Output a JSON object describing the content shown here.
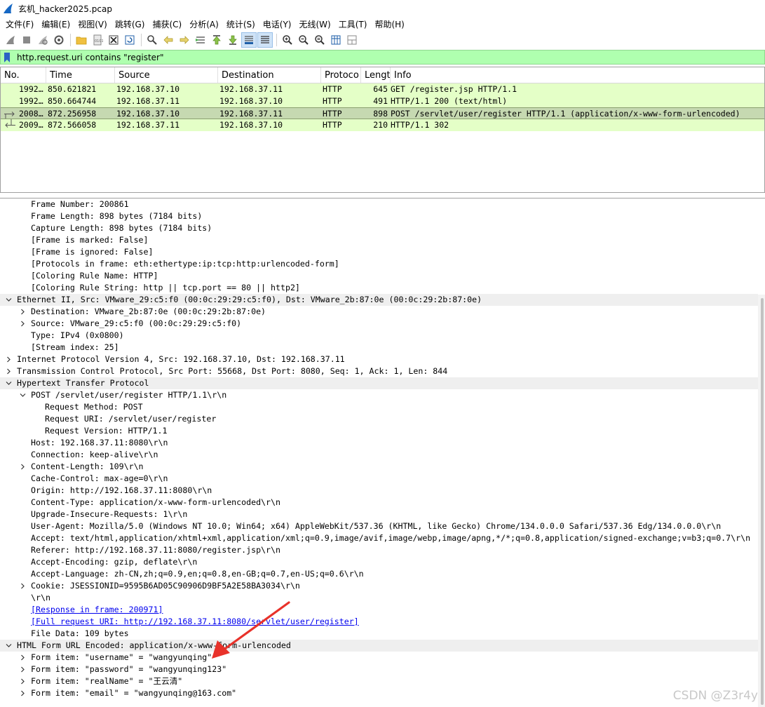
{
  "window": {
    "title": "玄机_hacker2025.pcap"
  },
  "menu": [
    "文件(F)",
    "编辑(E)",
    "视图(V)",
    "跳转(G)",
    "捕获(C)",
    "分析(A)",
    "统计(S)",
    "电话(Y)",
    "无线(W)",
    "工具(T)",
    "帮助(H)"
  ],
  "toolbar_icons": [
    "shark-start-icon",
    "stop-icon",
    "restart-icon",
    "options-icon",
    "open-folder-icon",
    "save-icon",
    "close-file-icon",
    "reload-icon",
    "find-icon",
    "go-back-icon",
    "go-forward-icon",
    "go-to-packet-icon",
    "first-packet-icon",
    "last-packet-icon",
    "autoscroll-icon",
    "colorize-icon",
    "zoom-in-icon",
    "zoom-out-icon",
    "zoom-normal-icon",
    "resize-columns-icon",
    "layout-icon"
  ],
  "filter": {
    "value": "http.request.uri contains \"register\""
  },
  "packet_list": {
    "columns": [
      "No.",
      "Time",
      "Source",
      "Destination",
      "Protoco",
      "Lengt",
      "Info"
    ],
    "rows": [
      {
        "no": "1992…",
        "time": "850.621821",
        "src": "192.168.37.10",
        "dst": "192.168.37.11",
        "proto": "HTTP",
        "len": "645",
        "info": "GET /register.jsp HTTP/1.1",
        "rel": "none"
      },
      {
        "no": "1992…",
        "time": "850.664744",
        "src": "192.168.37.11",
        "dst": "192.168.37.10",
        "proto": "HTTP",
        "len": "491",
        "info": "HTTP/1.1 200   (text/html)",
        "rel": "none"
      },
      {
        "no": "2008…",
        "time": "872.256958",
        "src": "192.168.37.10",
        "dst": "192.168.37.11",
        "proto": "HTTP",
        "len": "898",
        "info": "POST /servlet/user/register HTTP/1.1  (application/x-www-form-urlencoded)",
        "rel": "request"
      },
      {
        "no": "2009…",
        "time": "872.566058",
        "src": "192.168.37.11",
        "dst": "192.168.37.10",
        "proto": "HTTP",
        "len": "210",
        "info": "HTTP/1.1 302",
        "rel": "response"
      }
    ]
  },
  "details": [
    {
      "indent": 2,
      "arrow": "",
      "text": "Frame Number: 200861"
    },
    {
      "indent": 2,
      "arrow": "",
      "text": "Frame Length: 898 bytes (7184 bits)"
    },
    {
      "indent": 2,
      "arrow": "",
      "text": "Capture Length: 898 bytes (7184 bits)"
    },
    {
      "indent": 2,
      "arrow": "",
      "text": "[Frame is marked: False]"
    },
    {
      "indent": 2,
      "arrow": "",
      "text": "[Frame is ignored: False]"
    },
    {
      "indent": 2,
      "arrow": "",
      "text": "[Protocols in frame: eth:ethertype:ip:tcp:http:urlencoded-form]"
    },
    {
      "indent": 2,
      "arrow": "",
      "text": "[Coloring Rule Name: HTTP]"
    },
    {
      "indent": 2,
      "arrow": "",
      "text": "[Coloring Rule String: http || tcp.port == 80 || http2]"
    },
    {
      "indent": 1,
      "arrow": "open",
      "text": "Ethernet II, Src: VMware_29:c5:f0 (00:0c:29:29:c5:f0), Dst: VMware_2b:87:0e (00:0c:29:2b:87:0e)",
      "hl": true
    },
    {
      "indent": 2,
      "arrow": "closed",
      "text": "Destination: VMware_2b:87:0e (00:0c:29:2b:87:0e)"
    },
    {
      "indent": 2,
      "arrow": "closed",
      "text": "Source: VMware_29:c5:f0 (00:0c:29:29:c5:f0)"
    },
    {
      "indent": 2,
      "arrow": "",
      "text": "Type: IPv4 (0x0800)"
    },
    {
      "indent": 2,
      "arrow": "",
      "text": "[Stream index: 25]"
    },
    {
      "indent": 1,
      "arrow": "closed",
      "text": "Internet Protocol Version 4, Src: 192.168.37.10, Dst: 192.168.37.11"
    },
    {
      "indent": 1,
      "arrow": "closed",
      "text": "Transmission Control Protocol, Src Port: 55668, Dst Port: 8080, Seq: 1, Ack: 1, Len: 844"
    },
    {
      "indent": 1,
      "arrow": "open",
      "text": "Hypertext Transfer Protocol",
      "hl": true
    },
    {
      "indent": 2,
      "arrow": "open",
      "text": "POST /servlet/user/register HTTP/1.1\\r\\n"
    },
    {
      "indent": 3,
      "arrow": "",
      "text": "Request Method: POST"
    },
    {
      "indent": 3,
      "arrow": "",
      "text": "Request URI: /servlet/user/register"
    },
    {
      "indent": 3,
      "arrow": "",
      "text": "Request Version: HTTP/1.1"
    },
    {
      "indent": 2,
      "arrow": "",
      "text": "Host: 192.168.37.11:8080\\r\\n"
    },
    {
      "indent": 2,
      "arrow": "",
      "text": "Connection: keep-alive\\r\\n"
    },
    {
      "indent": 2,
      "arrow": "closed",
      "text": "Content-Length: 109\\r\\n"
    },
    {
      "indent": 2,
      "arrow": "",
      "text": "Cache-Control: max-age=0\\r\\n"
    },
    {
      "indent": 2,
      "arrow": "",
      "text": "Origin: http://192.168.37.11:8080\\r\\n"
    },
    {
      "indent": 2,
      "arrow": "",
      "text": "Content-Type: application/x-www-form-urlencoded\\r\\n"
    },
    {
      "indent": 2,
      "arrow": "",
      "text": "Upgrade-Insecure-Requests: 1\\r\\n"
    },
    {
      "indent": 2,
      "arrow": "",
      "text": "User-Agent: Mozilla/5.0 (Windows NT 10.0; Win64; x64) AppleWebKit/537.36 (KHTML, like Gecko) Chrome/134.0.0.0 Safari/537.36 Edg/134.0.0.0\\r\\n"
    },
    {
      "indent": 2,
      "arrow": "",
      "text": "Accept: text/html,application/xhtml+xml,application/xml;q=0.9,image/avif,image/webp,image/apng,*/*;q=0.8,application/signed-exchange;v=b3;q=0.7\\r\\n"
    },
    {
      "indent": 2,
      "arrow": "",
      "text": "Referer: http://192.168.37.11:8080/register.jsp\\r\\n"
    },
    {
      "indent": 2,
      "arrow": "",
      "text": "Accept-Encoding: gzip, deflate\\r\\n"
    },
    {
      "indent": 2,
      "arrow": "",
      "text": "Accept-Language: zh-CN,zh;q=0.9,en;q=0.8,en-GB;q=0.7,en-US;q=0.6\\r\\n"
    },
    {
      "indent": 2,
      "arrow": "closed",
      "text": "Cookie: JSESSIONID=9595B6AD05C90906D9BF5A2E58BA3034\\r\\n"
    },
    {
      "indent": 2,
      "arrow": "",
      "text": "\\r\\n"
    },
    {
      "indent": 2,
      "arrow": "",
      "text": "[Response in frame: 200971]",
      "link": true
    },
    {
      "indent": 2,
      "arrow": "",
      "text": "[Full request URI: http://192.168.37.11:8080/servlet/user/register]",
      "link": true
    },
    {
      "indent": 2,
      "arrow": "",
      "text": "File Data: 109 bytes"
    },
    {
      "indent": 1,
      "arrow": "open",
      "text": "HTML Form URL Encoded: application/x-www-form-urlencoded",
      "hl": true
    },
    {
      "indent": 2,
      "arrow": "closed",
      "text": "Form item: \"username\" = \"wangyunqing\""
    },
    {
      "indent": 2,
      "arrow": "closed",
      "text": "Form item: \"password\" = \"wangyunqing123\""
    },
    {
      "indent": 2,
      "arrow": "closed",
      "text": "Form item: \"realName\" = \"王云清\""
    },
    {
      "indent": 2,
      "arrow": "closed",
      "text": "Form item: \"email\" = \"wangyunqing@163.com\""
    }
  ],
  "watermark": "CSDN @Z3r4y",
  "colors": {
    "http_row": "#e4ffc7",
    "selected_row": "#c6d9b1",
    "filter_ok": "#afffaf",
    "annotation": "#e8322a"
  }
}
